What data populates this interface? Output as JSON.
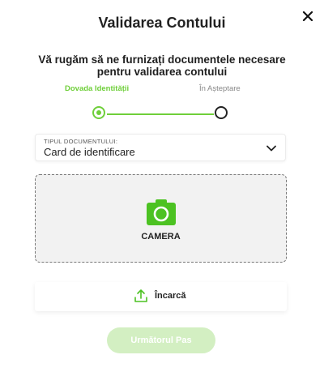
{
  "modal": {
    "title": "Validarea Contului",
    "subtitle": "Vă rugăm să ne furnizați documentele necesare pentru validarea contului"
  },
  "steps": [
    {
      "label": "Dovada Identității",
      "state": "active"
    },
    {
      "label": "În Așteptare",
      "state": "inactive"
    }
  ],
  "document_select": {
    "label": "TIPUL DOCUMENTULUI:",
    "value": "Card de identificare"
  },
  "camera": {
    "label": "CAMERA",
    "icon": "camera-icon"
  },
  "upload": {
    "label": "Încarcă",
    "icon": "upload-icon"
  },
  "next_button": {
    "label": "Următorul Pas",
    "enabled": false
  },
  "colors": {
    "accent": "#6fcf3a",
    "next_disabled_bg": "#d3efc2"
  }
}
